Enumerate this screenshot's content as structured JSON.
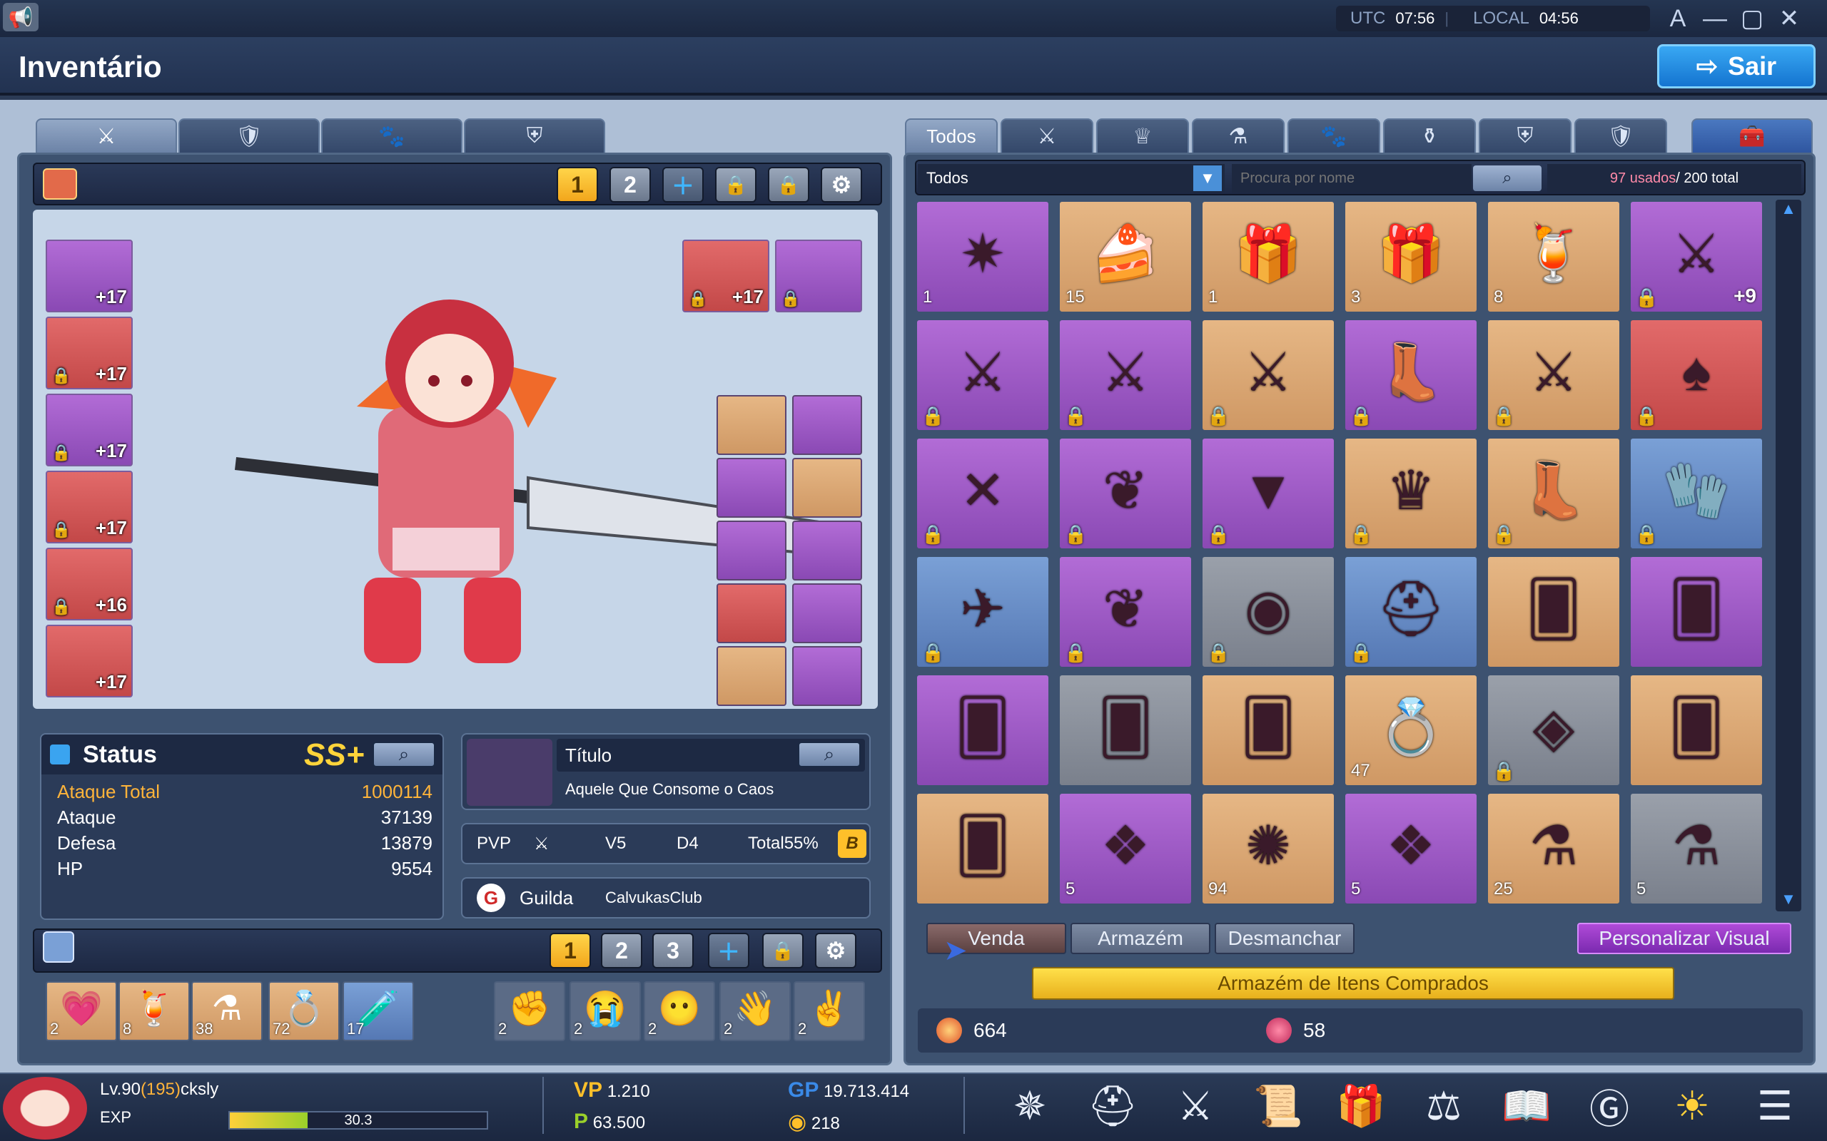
{
  "topbar": {
    "utc_label": "UTC",
    "utc_time": "07:56",
    "local_label": "LOCAL",
    "local_time": "04:56"
  },
  "window": {
    "title": "Inventário",
    "exit_label": "Sair"
  },
  "left_tabs": [
    "⚔",
    "🛡",
    "🐾",
    "⛨"
  ],
  "preset_top": [
    "1",
    "2"
  ],
  "equip_left": [
    {
      "plus": "+17",
      "color": "purple"
    },
    {
      "plus": "+17",
      "color": "red"
    },
    {
      "plus": "+17",
      "color": "purple"
    },
    {
      "plus": "+17",
      "color": "red"
    },
    {
      "plus": "+16",
      "color": "red"
    },
    {
      "plus": "+17",
      "color": "red"
    }
  ],
  "equip_top_right": [
    {
      "plus": "+17",
      "color": "red"
    },
    {
      "plus": "",
      "color": "purple"
    }
  ],
  "status": {
    "header": "Status",
    "rank": "SS+",
    "rows": [
      {
        "label": "Ataque Total",
        "value": "1000114"
      },
      {
        "label": "Ataque",
        "value": "37139"
      },
      {
        "label": "Defesa",
        "value": "13879"
      },
      {
        "label": "HP",
        "value": "9554"
      }
    ]
  },
  "title_box": {
    "header": "Título",
    "value": "Aquele Que Consome o Caos"
  },
  "pvp": {
    "label": "PVP",
    "v": "V5",
    "d": "D4",
    "total": "Total55%",
    "badge": "B"
  },
  "guild": {
    "label": "Guilda",
    "name": "CalvukasClub"
  },
  "preset_bottom": [
    "1",
    "2",
    "3"
  ],
  "quickslots": [
    "2",
    "8",
    "38",
    "72",
    "17"
  ],
  "emotes": [
    "2",
    "2",
    "2",
    "2",
    "2"
  ],
  "right_tabs": {
    "first": "Todos"
  },
  "filter": {
    "selected": "Todos",
    "search_placeholder": "Procura por nome",
    "used": "97 usados",
    "total": "/ 200 total"
  },
  "items": [
    {
      "c": "purple",
      "n": "1",
      "ic": "✷"
    },
    {
      "c": "tan",
      "n": "15",
      "ic": "🍰"
    },
    {
      "c": "tan",
      "n": "1",
      "ic": "🎁"
    },
    {
      "c": "tan",
      "n": "3",
      "ic": "🎁"
    },
    {
      "c": "tan",
      "n": "8",
      "ic": "🍹"
    },
    {
      "c": "purple",
      "n": "",
      "p": "+9",
      "ic": "⚔",
      "lk": 1
    },
    {
      "c": "purple",
      "n": "",
      "ic": "⚔",
      "lk": 1
    },
    {
      "c": "purple",
      "n": "",
      "ic": "⚔",
      "lk": 1
    },
    {
      "c": "tan",
      "n": "",
      "ic": "⚔",
      "lk": 1
    },
    {
      "c": "purple",
      "n": "",
      "ic": "👢",
      "lk": 1
    },
    {
      "c": "tan",
      "n": "",
      "ic": "⚔",
      "lk": 1
    },
    {
      "c": "red",
      "n": "",
      "ic": "♠",
      "lk": 1
    },
    {
      "c": "purple",
      "n": "",
      "ic": "✕",
      "lk": 1
    },
    {
      "c": "purple",
      "n": "",
      "ic": "❦",
      "lk": 1
    },
    {
      "c": "purple",
      "n": "",
      "ic": "▼",
      "lk": 1
    },
    {
      "c": "tan",
      "n": "",
      "ic": "♛",
      "lk": 1
    },
    {
      "c": "tan",
      "n": "",
      "ic": "👢",
      "lk": 1
    },
    {
      "c": "blue",
      "n": "",
      "ic": "🧤",
      "lk": 1
    },
    {
      "c": "blue",
      "n": "",
      "ic": "✈",
      "lk": 1
    },
    {
      "c": "purple",
      "n": "",
      "ic": "❦",
      "lk": 1
    },
    {
      "c": "gray",
      "n": "",
      "ic": "◉",
      "lk": 1
    },
    {
      "c": "blue",
      "n": "",
      "ic": "⛑",
      "lk": 1
    },
    {
      "c": "tan",
      "n": "",
      "ic": "🂠"
    },
    {
      "c": "purple",
      "n": "",
      "ic": "🂠"
    },
    {
      "c": "purple",
      "n": "",
      "ic": "🂠"
    },
    {
      "c": "gray",
      "n": "",
      "ic": "🂠"
    },
    {
      "c": "tan",
      "n": "",
      "ic": "🂠"
    },
    {
      "c": "tan",
      "n": "47",
      "ic": "💍"
    },
    {
      "c": "gray",
      "n": "",
      "ic": "◈",
      "lk": 1
    },
    {
      "c": "tan",
      "n": "",
      "ic": "🂠"
    },
    {
      "c": "tan",
      "n": "",
      "ic": "🂠"
    },
    {
      "c": "purple",
      "n": "5",
      "ic": "❖"
    },
    {
      "c": "tan",
      "n": "94",
      "ic": "✺"
    },
    {
      "c": "purple",
      "n": "5",
      "ic": "❖"
    },
    {
      "c": "tan",
      "n": "25",
      "ic": "⚗"
    },
    {
      "c": "gray",
      "n": "5",
      "ic": "⚗"
    }
  ],
  "actions": {
    "sell": "Venda",
    "storage": "Armazém",
    "dismantle": "Desmanchar",
    "custom": "Personalizar Visual",
    "bought": "Armazém de Itens Comprados"
  },
  "currency": {
    "a": "664",
    "b": "58"
  },
  "player": {
    "level": "Lv.90",
    "level_extra": "(195)",
    "name": "cksly",
    "exp_label": "EXP",
    "exp_value": "30.3",
    "exp_pct": 30.3
  },
  "money": {
    "vp_label": "VP",
    "vp": "1.210",
    "p": "63.500",
    "gp_label": "GP",
    "gp": "19.713.414",
    "coin": "218"
  }
}
